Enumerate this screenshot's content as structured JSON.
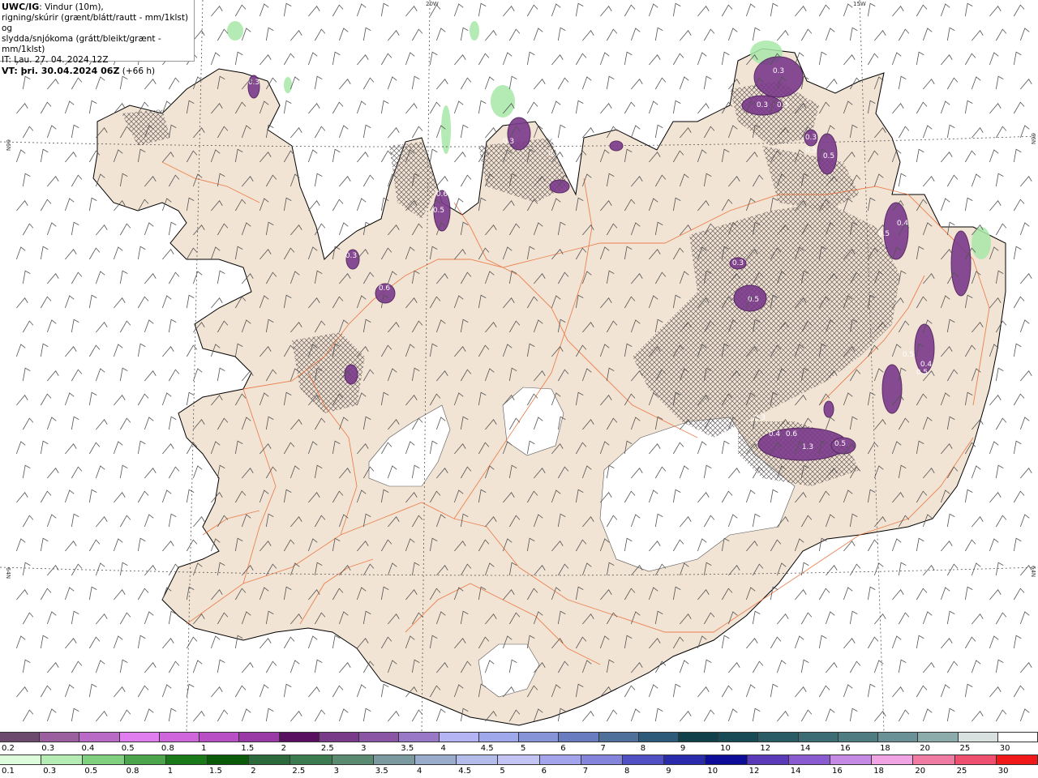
{
  "header": {
    "model": "UWC/IG",
    "line1_rest": ": Vindur (10m),",
    "line2": "rigning/skúrir (grænt/blátt/rautt - mm/1klst) og",
    "line3": "slydda/snjókoma (grátt/bleikt/grænt - mm/1klst)",
    "line4": "IT: Lau. 27. 04. 2024 12Z",
    "vt_label": "VT: þri. 30.04.2024 06Z",
    "vt_offset": "(+66 h)"
  },
  "axis_labels": {
    "top_20w": "20W",
    "top_15w": "15W",
    "left_66n": "66N",
    "right_66n": "66N",
    "left_64n": "64N",
    "right_64n": "64N"
  },
  "snow_scale": {
    "labels": [
      "0.2",
      "0.3",
      "0.4",
      "0.5",
      "0.8",
      "1",
      "1.5",
      "2",
      "2.5",
      "3",
      "3.5",
      "4",
      "4.5",
      "5",
      "6",
      "7",
      "8",
      "9",
      "10",
      "12",
      "14",
      "16",
      "18",
      "20",
      "25",
      "30"
    ],
    "colors": [
      "#6b4a6e",
      "#9b5fa0",
      "#b86ac6",
      "#e07ef0",
      "#d066dc",
      "#b84fc4",
      "#9a3aa6",
      "#5a1060",
      "#7a3a8a",
      "#8a55a4",
      "#9a78c8",
      "#b4b4f4",
      "#a0a8ec",
      "#8894d8",
      "#6a7cc0",
      "#50709c",
      "#2c5a78",
      "#10404a",
      "#184a56",
      "#2a5c66",
      "#3c6c74",
      "#4e7c80",
      "#6a9296",
      "#8cacac",
      "#d8e0e0",
      "#ffffff"
    ]
  },
  "rain_scale": {
    "labels": [
      "0.1",
      "0.3",
      "0.5",
      "0.8",
      "1",
      "1.5",
      "2",
      "2.5",
      "3",
      "3.5",
      "4",
      "4.5",
      "5",
      "6",
      "7",
      "8",
      "9",
      "10",
      "12",
      "14",
      "16",
      "18",
      "20",
      "25",
      "30"
    ],
    "colors": [
      "#dcfcdc",
      "#b4ecb4",
      "#80d080",
      "#4ca44c",
      "#1a7a1a",
      "#0a5a0a",
      "#2c6a3c",
      "#3c7a50",
      "#5a8a70",
      "#7a9aa0",
      "#9aaccc",
      "#b4bcec",
      "#c4c4f4",
      "#a4a4ec",
      "#8484dc",
      "#5050c4",
      "#2a2aac",
      "#0c0c98",
      "#5a3ab8",
      "#8a5ad0",
      "#c48ae4",
      "#f0a4e4",
      "#f07ca4",
      "#f05070",
      "#f01818"
    ]
  },
  "contour_labels": [
    "0.3",
    "0.3",
    "0.3",
    "0.3",
    "0.5",
    "0.3",
    "0.5",
    "0.3",
    "0.3",
    "0.5",
    "0.6",
    "0.3",
    "0.6",
    "0.3",
    "0.5",
    "0.4",
    "0.5",
    "0.4",
    "0.5",
    "0.5",
    "0.3",
    "0.4",
    "0.6",
    "1.3",
    "0.5"
  ],
  "colors": {
    "land": "#f2e4d4",
    "glacier": "#ffffff",
    "road": "#e8703a",
    "coast": "#000000",
    "grid": "#555555",
    "snow_patch": "#7a3a8a",
    "rain_patch": "#a8e8a8"
  },
  "icons": [
    "wind-barb-icon"
  ]
}
